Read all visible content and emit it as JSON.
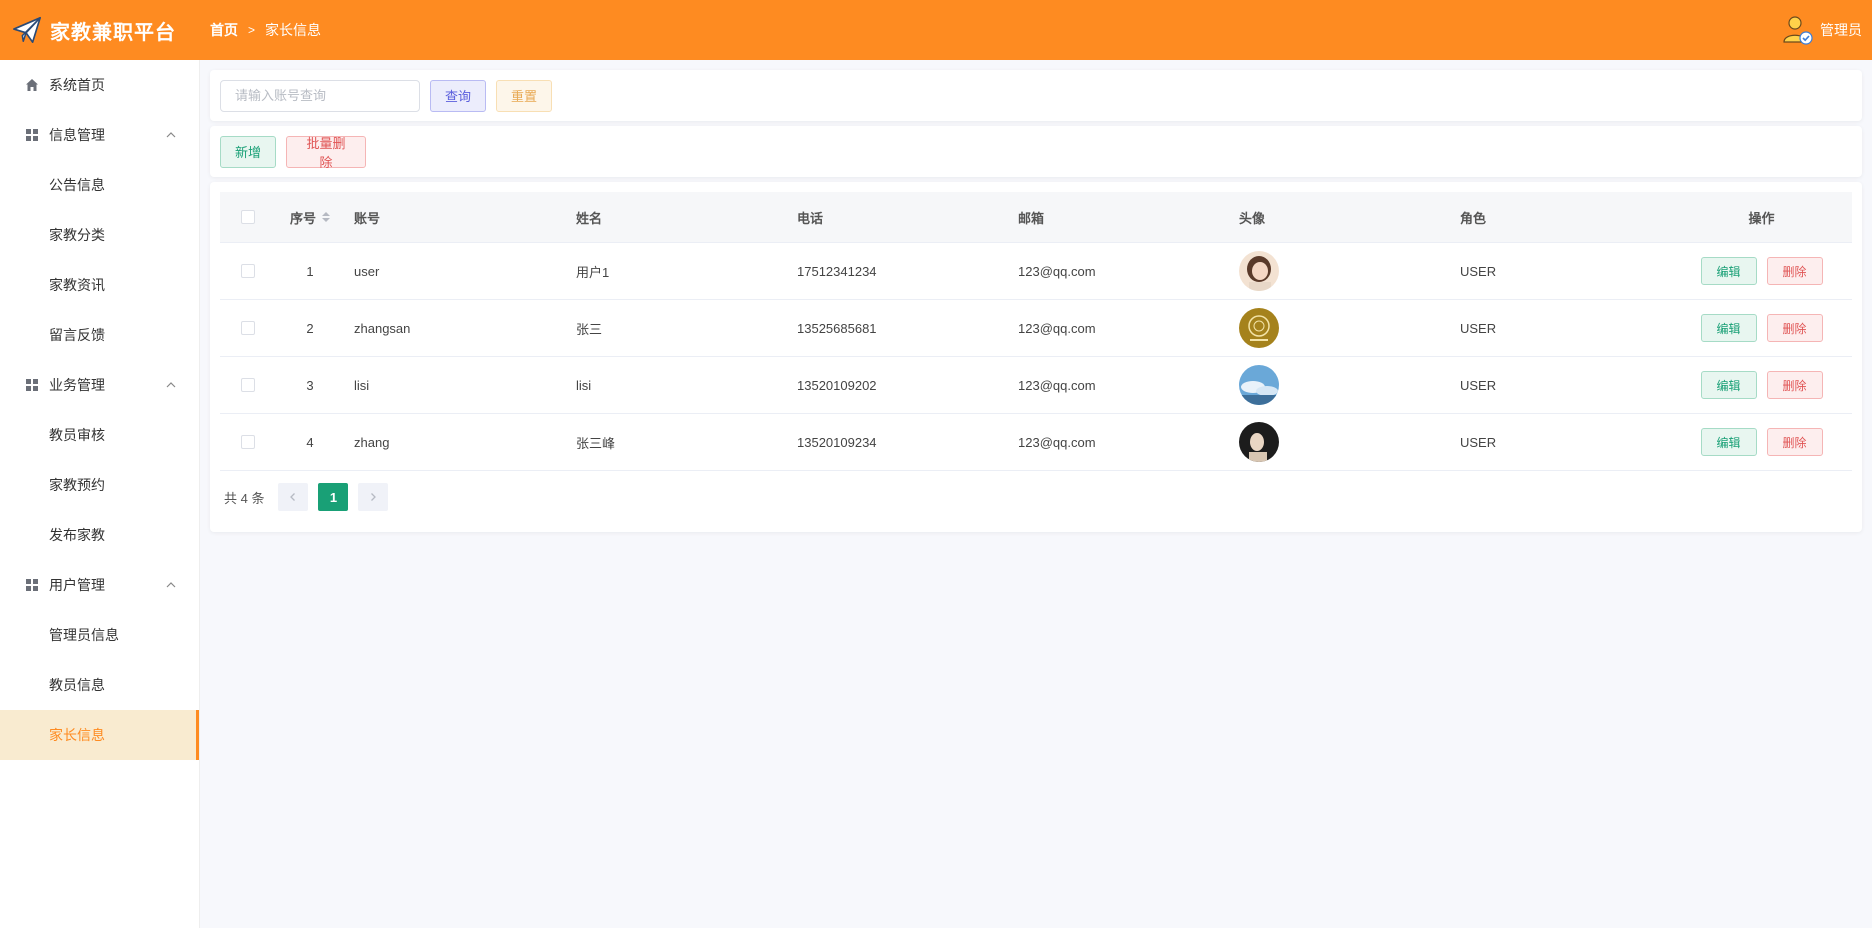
{
  "app": {
    "title": "家教兼职平台"
  },
  "breadcrumb": {
    "home": "首页",
    "current": "家长信息"
  },
  "user": {
    "name": "管理员"
  },
  "sidebar": {
    "home": "系统首页",
    "groups": [
      {
        "label": "信息管理",
        "items": [
          "公告信息",
          "家教分类",
          "家教资讯",
          "留言反馈"
        ]
      },
      {
        "label": "业务管理",
        "items": [
          "教员审核",
          "家教预约",
          "发布家教"
        ]
      },
      {
        "label": "用户管理",
        "items": [
          "管理员信息",
          "教员信息",
          "家长信息"
        ]
      }
    ],
    "active": "家长信息"
  },
  "search": {
    "placeholder": "请输入账号查询",
    "value": "",
    "query_label": "查询",
    "reset_label": "重置"
  },
  "actions": {
    "add_label": "新增",
    "batch_delete_label": "批量删除"
  },
  "table": {
    "headers": {
      "index": "序号",
      "account": "账号",
      "name": "姓名",
      "phone": "电话",
      "email": "邮箱",
      "avatar": "头像",
      "role": "角色",
      "ops": "操作"
    },
    "rows": [
      {
        "index": "1",
        "account": "user",
        "name": "用户1",
        "phone": "17512341234",
        "email": "123@qq.com",
        "avatar": "avatar-girl",
        "role": "USER"
      },
      {
        "index": "2",
        "account": "zhangsan",
        "name": "张三",
        "phone": "13525685681",
        "email": "123@qq.com",
        "avatar": "avatar-gold-emblem",
        "role": "USER"
      },
      {
        "index": "3",
        "account": "lisi",
        "name": "lisi",
        "phone": "13520109202",
        "email": "123@qq.com",
        "avatar": "avatar-sky",
        "role": "USER"
      },
      {
        "index": "4",
        "account": "zhang",
        "name": "张三峰",
        "phone": "13520109234",
        "email": "123@qq.com",
        "avatar": "avatar-dark-portrait",
        "role": "USER"
      }
    ],
    "edit_label": "编辑",
    "delete_label": "删除"
  },
  "pager": {
    "total_text": "共 4 条",
    "current_page": "1"
  },
  "colors": {
    "brand": "#fe8b21",
    "success": "#19a076",
    "danger": "#e05454",
    "primary": "#5a5edc"
  }
}
